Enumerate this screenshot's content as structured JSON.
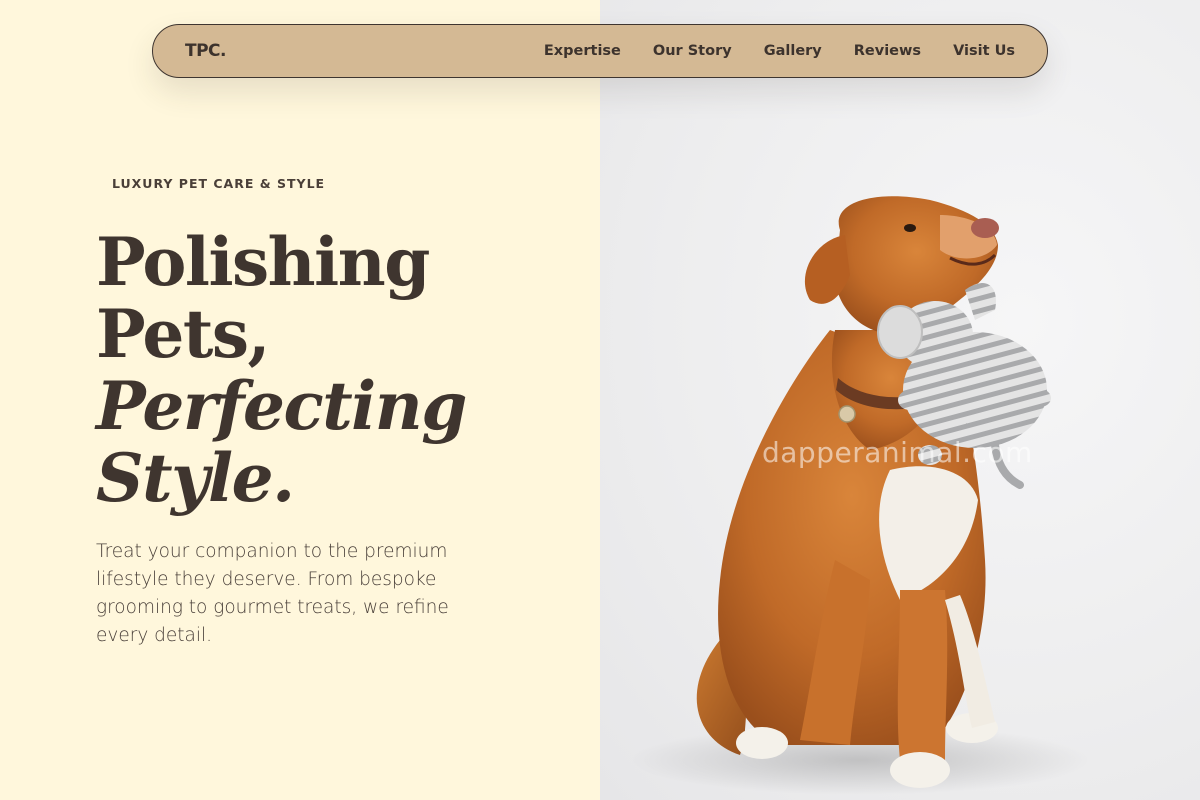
{
  "nav": {
    "logo": "TPC.",
    "links": [
      "Expertise",
      "Our Story",
      "Gallery",
      "Reviews",
      "Visit Us"
    ]
  },
  "hero": {
    "eyebrow": "LUXURY PET CARE & STYLE",
    "headline": {
      "line1": "Polishing",
      "line2": "Pets,",
      "line3": "Perfecting",
      "line4": "Style."
    },
    "subtext": "Treat your companion to the premium lifestyle they deserve. From bespoke grooming to gourmet treats, we refine every detail."
  },
  "image": {
    "subject": "dog-with-elephant-toy-photo",
    "watermark": "dapperanimal.com"
  },
  "colors": {
    "left_bg": "#fff7dc",
    "nav_bg": "#d4b994",
    "text_dark": "#3f352f",
    "right_bg": "#ededee"
  }
}
